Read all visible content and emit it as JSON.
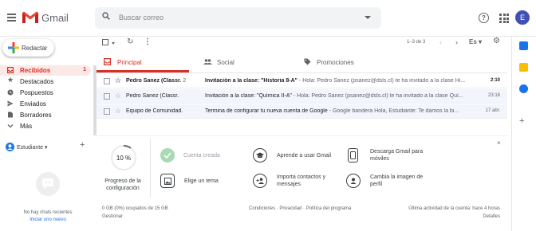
{
  "header": {
    "app_name": "Gmail",
    "search_placeholder": "Buscar correo",
    "avatar_letter": "E",
    "help_glyph": "?"
  },
  "sidebar": {
    "compose_label": "Redactar",
    "items": [
      {
        "label": "Recibidos",
        "count": "1",
        "icon": "inbox-icon",
        "active": true
      },
      {
        "label": "Destacados",
        "count": "",
        "icon": "star-icon",
        "active": false
      },
      {
        "label": "Pospuestos",
        "count": "",
        "icon": "clock-icon",
        "active": false
      },
      {
        "label": "Enviados",
        "count": "",
        "icon": "send-icon",
        "active": false
      },
      {
        "label": "Borradores",
        "count": "",
        "icon": "draft-icon",
        "active": false
      },
      {
        "label": "Más",
        "count": "",
        "icon": "chevron-down-icon",
        "active": false
      }
    ]
  },
  "chat": {
    "user_label": "Estudiante ▾",
    "plus": "+",
    "empty_text": "No hay chats recientes",
    "start_link": "Iniciar uno nuevo"
  },
  "toolbar": {
    "range": "1–3 de 3",
    "prev": "‹",
    "next": "›",
    "lang": "Es ▾"
  },
  "tabs": [
    {
      "label": "Principal",
      "icon": "inbox-tab-icon",
      "active": true
    },
    {
      "label": "Social",
      "icon": "people-icon",
      "active": false
    },
    {
      "label": "Promociones",
      "icon": "tag-icon",
      "active": false
    }
  ],
  "emails": [
    {
      "sender": "Pedro Sanez (Classr.",
      "count": "2",
      "subject": "Invitación a la clase: \"Historia 8-A\"",
      "snippet": " - Hola: Pedro Sanez (psanez@dsls.cl) te ha invitado a la clase Hi...",
      "date": "2:10",
      "unread": true
    },
    {
      "sender": "Pedro Sanez (Classr.",
      "count": "",
      "subject": "Invitación a la clase: \"Química II-A\"",
      "snippet": " - Hola: Pedro Sanez (psanez@dsls.cl) te ha invitado a la clase Quí...",
      "date": "23:18",
      "unread": false
    },
    {
      "sender": "Equipo de Comunidad.",
      "count": "",
      "subject": "Termina de configurar tu nueva cuenta de Google",
      "snippet": " - Google bandera Hola, Estudiante: Te damos la bi...",
      "date": "17 abr.",
      "unread": false
    }
  ],
  "onboarding": {
    "close": "×",
    "progress_fraction": 0.1,
    "progress_text": "10 %",
    "progress_label": "Progreso de la configuración",
    "tasks": [
      {
        "label": "Cuenta creada",
        "icon": "check-icon",
        "done": true
      },
      {
        "label": "Aprende a usar Gmail",
        "icon": "school-icon",
        "done": false
      },
      {
        "label": "Descarga Gmail para móviles",
        "icon": "phone-icon",
        "done": false
      },
      {
        "label": "Elige un tema",
        "icon": "theme-icon",
        "done": false
      },
      {
        "label": "Importa contactos y mensajes",
        "icon": "add-contact-icon",
        "done": false
      },
      {
        "label": "Cambia la imagen de perfil",
        "icon": "profile-icon",
        "done": false
      }
    ]
  },
  "footer": {
    "storage": "0 GB (0%) ocupados de 15 GB",
    "manage": "Gestionar",
    "terms": "Condiciones · Privacidad · Política del programa",
    "activity": "Última actividad de la cuenta: hace 4 horas",
    "details": "Detalles"
  },
  "colors": {
    "accent": "#d93025",
    "avatar": "#3f51b5",
    "link": "#1a73e8"
  }
}
